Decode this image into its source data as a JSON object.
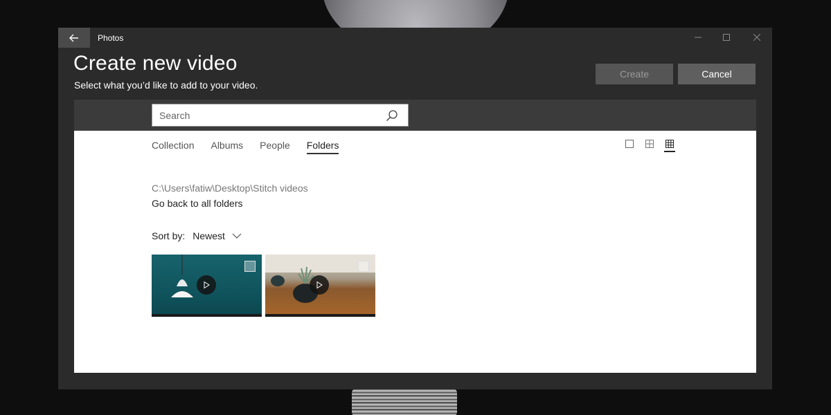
{
  "window": {
    "app_title": "Photos",
    "back_icon": "arrow-left-icon",
    "controls": [
      "minimize-icon",
      "maximize-icon",
      "close-icon"
    ]
  },
  "header": {
    "title": "Create new video",
    "subtitle": "Select what you’d like to add to your video.",
    "create_label": "Create",
    "cancel_label": "Cancel"
  },
  "search": {
    "placeholder": "Search",
    "value": ""
  },
  "tabs": [
    {
      "label": "Collection",
      "active": false
    },
    {
      "label": "Albums",
      "active": false
    },
    {
      "label": "People",
      "active": false
    },
    {
      "label": "Folders",
      "active": true
    }
  ],
  "view_toggles": [
    {
      "icon": "single-view-icon",
      "active": false
    },
    {
      "icon": "medium-grid-icon",
      "active": false
    },
    {
      "icon": "small-grid-icon",
      "active": true
    }
  ],
  "folder": {
    "path": "C:\\Users\\fatiw\\Desktop\\Stitch videos",
    "back_link": "Go back to all folders"
  },
  "sort": {
    "label": "Sort by:",
    "value": "Newest"
  },
  "items": [
    {
      "type": "video",
      "icon": "play-icon",
      "thumb": "teal-lamp"
    },
    {
      "type": "video",
      "icon": "play-icon",
      "thumb": "plant-on-table"
    }
  ],
  "colors": {
    "window_bg": "#2b2b2b",
    "search_strip": "#3b3b3b",
    "content_bg": "#ffffff",
    "button_bg": "#5f5f5f"
  }
}
